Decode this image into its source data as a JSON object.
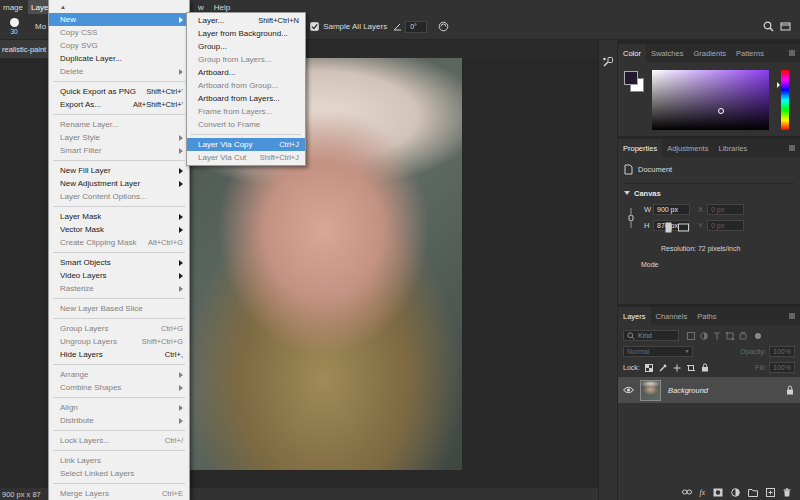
{
  "menu_bar": {
    "items": [
      {
        "label": "mage",
        "selected": false
      },
      {
        "label": "Layer",
        "selected": true
      },
      {
        "label": "w",
        "selected": false
      },
      {
        "label": "Help",
        "selected": false
      }
    ]
  },
  "options_bar": {
    "brush_size": "30",
    "mode_label": "Mo",
    "sample_all_layers": {
      "label": "Sample All Layers",
      "checked": true
    },
    "angle": "0°"
  },
  "document": {
    "tab": "realistic-paint",
    "status": "900 px x 87"
  },
  "layer_menu": {
    "scroll_arrow": "▲",
    "groups": [
      [
        {
          "label": "New",
          "selected": true,
          "disabled": false,
          "submenu": true
        },
        {
          "label": "Copy CSS",
          "selected": false,
          "disabled": true,
          "submenu": false
        },
        {
          "label": "Copy SVG",
          "selected": false,
          "disabled": true,
          "submenu": false
        },
        {
          "label": "Duplicate Layer...",
          "selected": false,
          "disabled": false,
          "submenu": false
        },
        {
          "label": "Delete",
          "selected": false,
          "disabled": true,
          "submenu": true
        }
      ],
      [
        {
          "label": "Quick Export as PNG",
          "shortcut": "Shift+Ctrl+'",
          "selected": false,
          "disabled": false,
          "submenu": false
        },
        {
          "label": "Export As...",
          "shortcut": "Alt+Shift+Ctrl+'",
          "selected": false,
          "disabled": false,
          "submenu": false
        }
      ],
      [
        {
          "label": "Rename Layer...",
          "selected": false,
          "disabled": true,
          "submenu": false
        },
        {
          "label": "Layer Style",
          "selected": false,
          "disabled": true,
          "submenu": true
        },
        {
          "label": "Smart Filter",
          "selected": false,
          "disabled": true,
          "submenu": true
        }
      ],
      [
        {
          "label": "New Fill Layer",
          "selected": false,
          "disabled": false,
          "submenu": true
        },
        {
          "label": "New Adjustment Layer",
          "selected": false,
          "disabled": false,
          "submenu": true
        },
        {
          "label": "Layer Content Options...",
          "selected": false,
          "disabled": true,
          "submenu": false
        }
      ],
      [
        {
          "label": "Layer Mask",
          "selected": false,
          "disabled": false,
          "submenu": true
        },
        {
          "label": "Vector Mask",
          "selected": false,
          "disabled": false,
          "submenu": true
        },
        {
          "label": "Create Clipping Mask",
          "shortcut": "Alt+Ctrl+G",
          "selected": false,
          "disabled": true,
          "submenu": false
        }
      ],
      [
        {
          "label": "Smart Objects",
          "selected": false,
          "disabled": false,
          "submenu": true
        },
        {
          "label": "Video Layers",
          "selected": false,
          "disabled": false,
          "submenu": true
        },
        {
          "label": "Rasterize",
          "selected": false,
          "disabled": true,
          "submenu": true
        }
      ],
      [
        {
          "label": "New Layer Based Slice",
          "selected": false,
          "disabled": true,
          "submenu": false
        }
      ],
      [
        {
          "label": "Group Layers",
          "shortcut": "Ctrl+G",
          "selected": false,
          "disabled": true,
          "submenu": false
        },
        {
          "label": "Ungroup Layers",
          "shortcut": "Shift+Ctrl+G",
          "selected": false,
          "disabled": true,
          "submenu": false
        },
        {
          "label": "Hide Layers",
          "shortcut": "Ctrl+,",
          "selected": false,
          "disabled": false,
          "submenu": false
        }
      ],
      [
        {
          "label": "Arrange",
          "selected": false,
          "disabled": true,
          "submenu": true
        },
        {
          "label": "Combine Shapes",
          "selected": false,
          "disabled": true,
          "submenu": true
        }
      ],
      [
        {
          "label": "Align",
          "selected": false,
          "disabled": true,
          "submenu": true
        },
        {
          "label": "Distribute",
          "selected": false,
          "disabled": true,
          "submenu": true
        }
      ],
      [
        {
          "label": "Lock Layers...",
          "shortcut": "Ctrl+/",
          "selected": false,
          "disabled": true,
          "submenu": false
        }
      ],
      [
        {
          "label": "Link Layers",
          "selected": false,
          "disabled": true,
          "submenu": false
        },
        {
          "label": "Select Linked Layers",
          "selected": false,
          "disabled": true,
          "submenu": false
        }
      ],
      [
        {
          "label": "Merge Layers",
          "shortcut": "Ctrl+E",
          "selected": false,
          "disabled": true,
          "submenu": false
        }
      ]
    ]
  },
  "new_submenu": {
    "groups": [
      [
        {
          "label": "Layer...",
          "shortcut": "Shift+Ctrl+N",
          "selected": false,
          "disabled": false,
          "submenu": false
        },
        {
          "label": "Layer from Background...",
          "selected": false,
          "disabled": false,
          "submenu": false
        },
        {
          "label": "Group...",
          "selected": false,
          "disabled": false,
          "submenu": false
        },
        {
          "label": "Group from Layers...",
          "selected": false,
          "disabled": true,
          "submenu": false
        },
        {
          "label": "Artboard...",
          "selected": false,
          "disabled": false,
          "submenu": false
        },
        {
          "label": "Artboard from Group...",
          "selected": false,
          "disabled": true,
          "submenu": false
        },
        {
          "label": "Artboard from Layers...",
          "selected": false,
          "disabled": false,
          "submenu": false
        },
        {
          "label": "Frame from Layers...",
          "selected": false,
          "disabled": true,
          "submenu": false
        },
        {
          "label": "Convert to Frame",
          "selected": false,
          "disabled": true,
          "submenu": false
        }
      ],
      [
        {
          "label": "Layer Via Copy",
          "shortcut": "Ctrl+J",
          "selected": true,
          "disabled": false,
          "submenu": false
        },
        {
          "label": "Layer Via Cut",
          "shortcut": "Shift+Ctrl+J",
          "selected": false,
          "disabled": true,
          "submenu": false
        }
      ]
    ]
  },
  "color_panel": {
    "tabs": [
      {
        "label": "Color",
        "selected": true
      },
      {
        "label": "Swatches",
        "selected": false
      },
      {
        "label": "Gradients",
        "selected": false
      },
      {
        "label": "Patterns",
        "selected": false
      }
    ]
  },
  "properties_panel": {
    "tabs": [
      {
        "label": "Properties",
        "selected": true
      },
      {
        "label": "Adjustments",
        "selected": false
      },
      {
        "label": "Libraries",
        "selected": false
      }
    ],
    "document_label": "Document",
    "section": {
      "label": "Canvas",
      "expanded": true
    },
    "rows": [
      [
        {
          "label": "W",
          "value": "900 px",
          "disabled": false
        },
        {
          "label": "X",
          "value": "0 px",
          "disabled": true
        }
      ],
      [
        {
          "label": "H",
          "value": "874 px",
          "disabled": false
        },
        {
          "label": "Y",
          "value": "0 px",
          "disabled": true
        }
      ]
    ],
    "resolution": "Resolution: 72 pixels/inch",
    "mode_label": "Mode"
  },
  "layers_panel": {
    "tabs": [
      {
        "label": "Layers",
        "selected": true
      },
      {
        "label": "Channels",
        "selected": false
      },
      {
        "label": "Paths",
        "selected": false
      }
    ],
    "filter_label": "Kind",
    "blend_mode": {
      "value": "Normal",
      "disabled": true
    },
    "opacity": {
      "label": "Opacity:",
      "value": "100%",
      "disabled": true
    },
    "lock_label": "Lock:",
    "fill": {
      "label": "Fill:",
      "value": "100%",
      "disabled": true
    },
    "layers": [
      {
        "name": "Background",
        "visible": true,
        "locked": true,
        "selected": true
      }
    ],
    "fx_button": "fx"
  }
}
